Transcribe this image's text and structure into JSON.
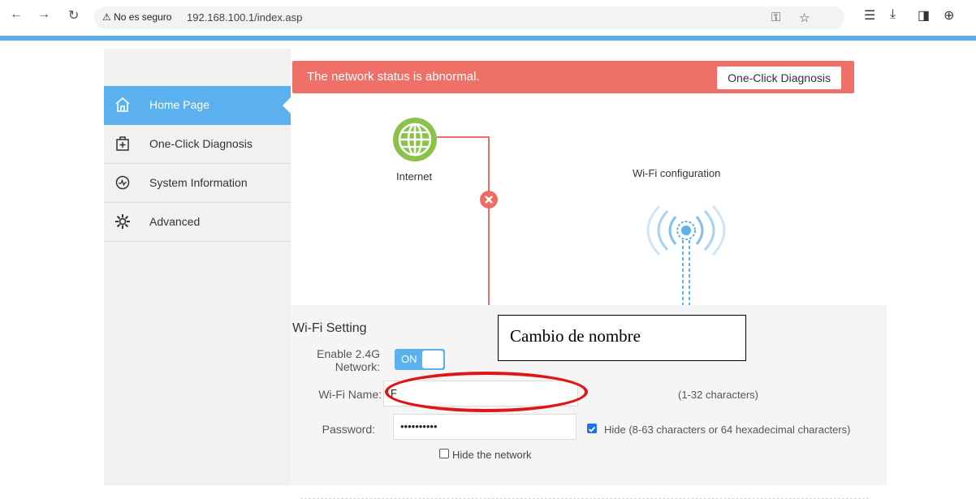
{
  "browser": {
    "security_label": "No es seguro",
    "url": "192.168.100.1/index.asp"
  },
  "sidebar": {
    "items": [
      {
        "label": "Home Page",
        "icon": "home-icon",
        "active": true
      },
      {
        "label": "One-Click Diagnosis",
        "icon": "medical-kit-icon",
        "active": false
      },
      {
        "label": "System Information",
        "icon": "gauge-icon",
        "active": false
      },
      {
        "label": "Advanced",
        "icon": "gear-icon",
        "active": false
      }
    ]
  },
  "alert": {
    "message": "The network status is abnormal.",
    "button_label": "One-Click Diagnosis"
  },
  "diagram": {
    "internet_label": "Internet",
    "wifi_label": "Wi-Fi configuration"
  },
  "wifi_setting": {
    "title": "Wi-Fi Setting",
    "enable_label": "Enable 2.4G Network:",
    "toggle_label": "ON",
    "name_label": "Wi-Fi Name:",
    "name_value": "F",
    "name_hint": "(1-32 characters)",
    "password_label": "Password:",
    "password_value": "••••••••••",
    "password_hint": "Hide (8-63 characters or 64 hexadecimal characters)",
    "hide_network_label": "Hide the network"
  },
  "annotation": {
    "text": "Cambio de nombre"
  },
  "colors": {
    "accent": "#5ab1ee",
    "alert": "#ee7067",
    "internet_globe": "#8bc34a",
    "error": "#ee6c62",
    "annotation_ellipse": "#e01515"
  }
}
